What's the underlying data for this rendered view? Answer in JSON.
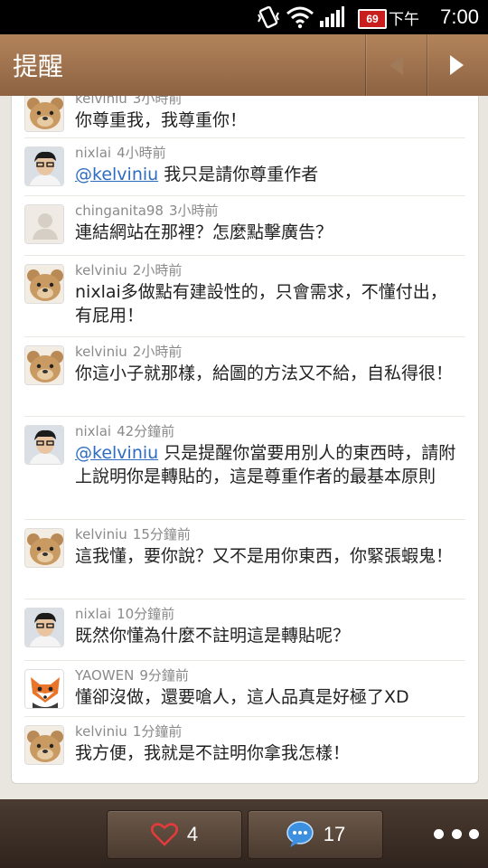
{
  "status_bar": {
    "battery": "69",
    "ampm": "下午",
    "time": "7:00"
  },
  "header": {
    "title": "提醒"
  },
  "comments": [
    {
      "user": "kelviniu",
      "time": "3小時前",
      "text": "你尊重我，我尊重你！",
      "avatar": "bear"
    },
    {
      "user": "nixlai",
      "time": "4小時前",
      "mention": "@kelviniu",
      "text": "我只是請你尊重作者",
      "avatar": "person"
    },
    {
      "user": "chinganita98",
      "time": "3小時前",
      "text": "連結網站在那裡？怎麼點擊廣告？",
      "avatar": "default"
    },
    {
      "user": "kelviniu",
      "time": "2小時前",
      "text": "nixlai多做點有建設性的，只會需求，不懂付出，有屁用！",
      "avatar": "bear"
    },
    {
      "user": "kelviniu",
      "time": "2小時前",
      "text": "你這小子就那樣，給圖的方法又不給，自私得很！",
      "avatar": "bear"
    },
    {
      "user": "nixlai",
      "time": "42分鐘前",
      "mention": "@kelviniu",
      "text": "只是提醒你當要用別人的東西時，請附上說明你是轉貼的，這是尊重作者的最基本原則",
      "avatar": "person"
    },
    {
      "user": "kelviniu",
      "time": "15分鐘前",
      "text": "這我懂，要你說？又不是用你東西，你緊張蝦鬼！",
      "avatar": "bear"
    },
    {
      "user": "nixlai",
      "time": "10分鐘前",
      "text": "既然你懂為什麼不註明這是轉貼呢？",
      "avatar": "person"
    },
    {
      "user": "YAOWEN",
      "time": "9分鐘前",
      "text": "懂卻沒做，還要嗆人，這人品真是好極了XD",
      "avatar": "fox"
    },
    {
      "user": "kelviniu",
      "time": "1分鐘前",
      "text": "我方便，我就是不註明你拿我怎樣！",
      "avatar": "bear"
    }
  ],
  "bottom_bar": {
    "likes": "4",
    "comments": "17"
  }
}
